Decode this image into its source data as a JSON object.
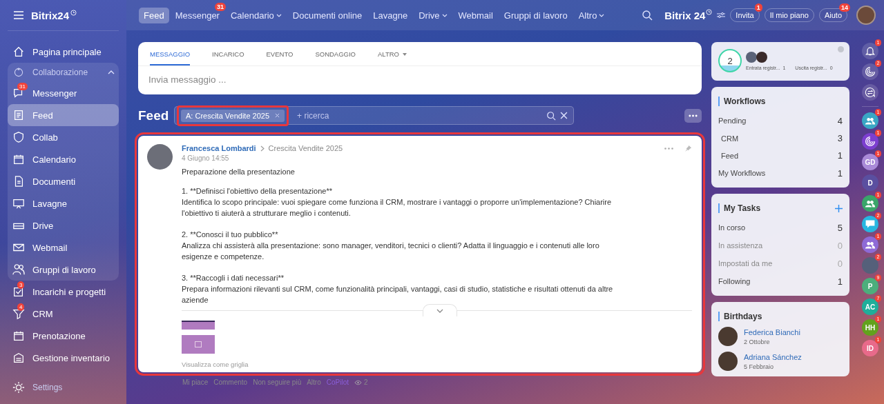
{
  "sidebar": {
    "logo": "Bitrix24",
    "items": [
      {
        "label": "Pagina principale",
        "kind": "item",
        "selected": false
      },
      {
        "label": "Collaborazione",
        "kind": "group",
        "expanded": true,
        "children": [
          {
            "label": "Messenger",
            "badge": "31",
            "selected": false
          },
          {
            "label": "Feed",
            "selected": true
          },
          {
            "label": "Collab",
            "selected": false
          },
          {
            "label": "Calendario",
            "selected": false
          },
          {
            "label": "Documenti",
            "selected": false
          },
          {
            "label": "Lavagne",
            "selected": false
          },
          {
            "label": "Drive",
            "selected": false
          },
          {
            "label": "Webmail",
            "selected": false
          },
          {
            "label": "Gruppi di lavoro",
            "selected": false
          }
        ]
      },
      {
        "label": "Incarichi e progetti",
        "kind": "item",
        "badge": "3",
        "selected": false
      },
      {
        "label": "CRM",
        "kind": "item",
        "badge": "4",
        "selected": false
      },
      {
        "label": "Prenotazione",
        "kind": "item",
        "selected": false
      },
      {
        "label": "Gestione inventario",
        "kind": "item",
        "selected": false
      }
    ],
    "footer": "Settings"
  },
  "top_nav": [
    {
      "label": "Feed",
      "selected": true,
      "dropdown": false
    },
    {
      "label": "Messenger",
      "badge": "31",
      "selected": false,
      "dropdown": false
    },
    {
      "label": "Calendario",
      "selected": false,
      "dropdown": true
    },
    {
      "label": "Documenti online",
      "selected": false,
      "dropdown": false
    },
    {
      "label": "Lavagne",
      "selected": false,
      "dropdown": false
    },
    {
      "label": "Drive",
      "selected": false,
      "dropdown": true
    },
    {
      "label": "Webmail",
      "selected": false,
      "dropdown": false
    },
    {
      "label": "Gruppi di lavoro",
      "selected": false,
      "dropdown": false
    },
    {
      "label": "Altro",
      "selected": false,
      "dropdown": true
    }
  ],
  "header": {
    "logo": "Bitrix 24",
    "buttons": [
      {
        "label": "Invita",
        "badge": "1"
      },
      {
        "label": "Il mio piano"
      },
      {
        "label": "Aiuto",
        "badge": "14"
      }
    ]
  },
  "composer": {
    "tabs": [
      {
        "label": "MESSAGGIO",
        "selected": true,
        "dropdown": false
      },
      {
        "label": "INCARICO",
        "selected": false,
        "dropdown": false
      },
      {
        "label": "EVENTO",
        "selected": false,
        "dropdown": false
      },
      {
        "label": "SONDAGGIO",
        "selected": false,
        "dropdown": false
      },
      {
        "label": "ALTRO",
        "selected": false,
        "dropdown": true
      }
    ],
    "placeholder": "Invia messaggio ..."
  },
  "feed": {
    "title": "Feed",
    "filter_chip": {
      "label": "A: Crescita Vendite 2025",
      "highlighted": true
    },
    "search": {
      "placeholder": "+ ricerca"
    }
  },
  "post": {
    "highlighted": true,
    "author": "Francesca Lombardi",
    "target": "Crescita Vendite 2025",
    "date": "4 Giugno 14:55",
    "paragraphs": [
      "Preparazione della presentazione",
      "1. **Definisci l'obiettivo della presentazione**\nIdentifica lo scopo principale: vuoi spiegare come funziona il CRM, mostrare i vantaggi o proporre un'implementazione? Chiarire l'obiettivo ti aiuterà a strutturare meglio i contenuti.",
      "2. **Conosci il tuo pubblico**\nAnalizza chi assisterà alla presentazione: sono manager, venditori, tecnici o clienti? Adatta il linguaggio e i contenuti alle loro esigenze e competenze.",
      "3. **Raccogli i dati necessari**\nPrepara informazioni rilevanti sul CRM, come funzionalità principali, vantaggi, casi di studio, statistiche e risultati ottenuti da altre aziende"
    ],
    "grid_link": "Visualizza come griglia",
    "actions": [
      "Mi piace",
      "Commento",
      "Non seguire più",
      "Altro",
      "CoPilot"
    ],
    "views": "2"
  },
  "timeman": {
    "count": "2",
    "stats": [
      {
        "label": "Entrata registr...",
        "value": "1"
      },
      {
        "label": "Uscita registr...",
        "value": "0"
      }
    ]
  },
  "workflows": {
    "title": "Workflows",
    "rows": [
      {
        "label": "Pending",
        "value": "4",
        "children": [
          {
            "label": "CRM",
            "value": "3"
          },
          {
            "label": "Feed",
            "value": "1"
          }
        ]
      },
      {
        "label": "My Workflows",
        "value": "1"
      }
    ]
  },
  "tasks": {
    "title": "My Tasks",
    "rows": [
      {
        "label": "In corso",
        "value": "5",
        "dimmed": false
      },
      {
        "label": "In assistenza",
        "value": "0",
        "dimmed": true
      },
      {
        "label": "Impostati da me",
        "value": "0",
        "dimmed": true
      },
      {
        "label": "Following",
        "value": "1",
        "dimmed": false
      }
    ]
  },
  "birthdays": {
    "title": "Birthdays",
    "people": [
      {
        "name": "Federica Bianchi",
        "date": "2 Ottobre"
      },
      {
        "name": "Adriana Sánchez",
        "date": "5 Febbraio"
      }
    ]
  },
  "rail": [
    {
      "kind": "bell",
      "badge": "1"
    },
    {
      "kind": "target",
      "badge": "2"
    },
    {
      "kind": "swap"
    },
    {
      "kind": "group",
      "color": "#3aa6c4",
      "badge": "1"
    },
    {
      "kind": "copilot",
      "color": "#7c3fd0",
      "badge": "1"
    },
    {
      "kind": "initials",
      "text": "GD",
      "color": "#a98ad8",
      "badge": "1"
    },
    {
      "kind": "initials",
      "text": "D",
      "color": "#5a4fa0"
    },
    {
      "kind": "group",
      "color": "#3aa56a",
      "badge": "1"
    },
    {
      "kind": "chat",
      "color": "#27b6e0",
      "badge": "2"
    },
    {
      "kind": "group",
      "color": "#8e6ad6",
      "badge": "1"
    },
    {
      "kind": "photo",
      "color": "#55607a",
      "badge": "2"
    },
    {
      "kind": "initials",
      "text": "P",
      "color": "#4cae7c",
      "badge": "9"
    },
    {
      "kind": "initials",
      "text": "AC",
      "color": "#1fae9a",
      "badge": "7"
    },
    {
      "kind": "initials",
      "text": "HH",
      "color": "#62a21d",
      "badge": "1"
    },
    {
      "kind": "initials",
      "text": "ID",
      "color": "#e86a8a",
      "badge": "1"
    }
  ]
}
